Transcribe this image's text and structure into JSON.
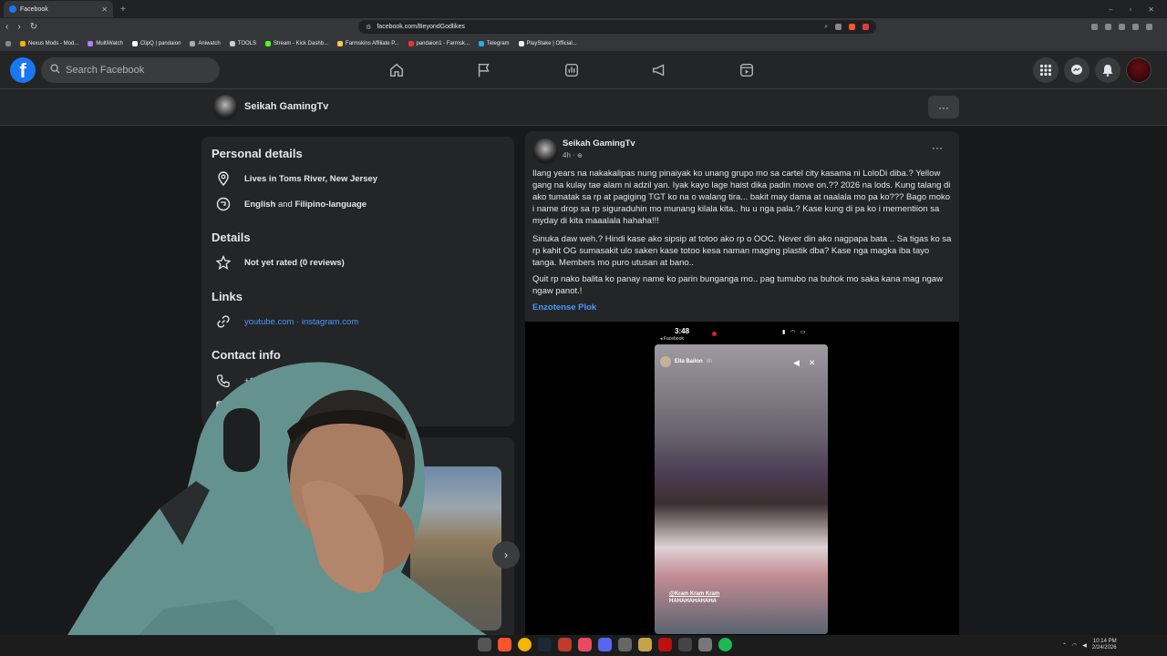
{
  "browser": {
    "tab_title": "Facebook",
    "url": "facebook.com/BeyondGodlikes",
    "bookmarks": [
      "Nexus Mods - Mod...",
      "MultiWatch",
      "ClipQ | pandaion",
      "Aniwatch",
      "TOOLS",
      "Stream - Kick Dashb...",
      "Farmskins Affiliate P...",
      "pandaion1 - Farmsk...",
      "Telegram",
      "PlayStake | Official..."
    ]
  },
  "facebook": {
    "search_placeholder": "Search Facebook",
    "profile_name": "Seikah GamingTv"
  },
  "about": {
    "personal_title": "Personal details",
    "lives": "Lives in Toms River, New Jersey",
    "languages_a": "English",
    "languages_and": " and ",
    "languages_b": "Filipino-language",
    "details_title": "Details",
    "rating": "Not yet rated (0 reviews)",
    "links_title": "Links",
    "link_youtube": "youtube.com",
    "link_sep": " · ",
    "link_instagram": "instagram.com",
    "contact_title": "Contact info",
    "phone_partial": "+1 5"
  },
  "post": {
    "author": "Seikah GamingTv",
    "time": "4h · ",
    "paragraph1": "Ilang years na nakakalipas nung pinaiyak ko unang grupo mo sa cartel  city kasama ni LoloDi diba.? Yellow gang na kulay tae alam ni adzil yan. Iyak kayo lage haist dika padin move on.?? 2026 na lods. Kung talang di ako tumatak sa rp at pagiging TGT ko na o walang tira... bakit may dama at naalala mo pa ko??? Bago moko i name drop sa rp siguraduhin mo munang kilala kita.. hu u nga pala.? Kase kung di pa ko i mementiion sa myday di kita maaalala hahaha!!!",
    "paragraph2": "Sinuka daw weh.? Hindi kase ako sipsip at totoo ako rp o OOC. Never din ako nagpapa bata .. Sa tigas ko sa rp kahit OG sumasakit ulo saken kase totoo kesa naman maging plastik dba? Kase nga magka iba tayo tanga. Members mo puro  utusan at bano..",
    "paragraph3": "Quit rp nako balita ko panay name ko parin bunganga mo.. pag tumubo na buhok mo saka kana mag ngaw ngaw panot.!",
    "tag": "Enzotense Plok",
    "story": {
      "clock": "3:48",
      "app": "◂ Facebook",
      "user": "Ella Bailon",
      "age": "8h",
      "caption_line1": "@Kram Kram Kram",
      "caption_line2": "HAHAHAHAHAHA"
    }
  },
  "taskbar": {
    "time": "10:14 PM",
    "date": "2/24/2026"
  },
  "colors": {
    "accent": "#1877f2",
    "link": "#4599ff",
    "surface": "#242526",
    "background": "#18191a"
  }
}
